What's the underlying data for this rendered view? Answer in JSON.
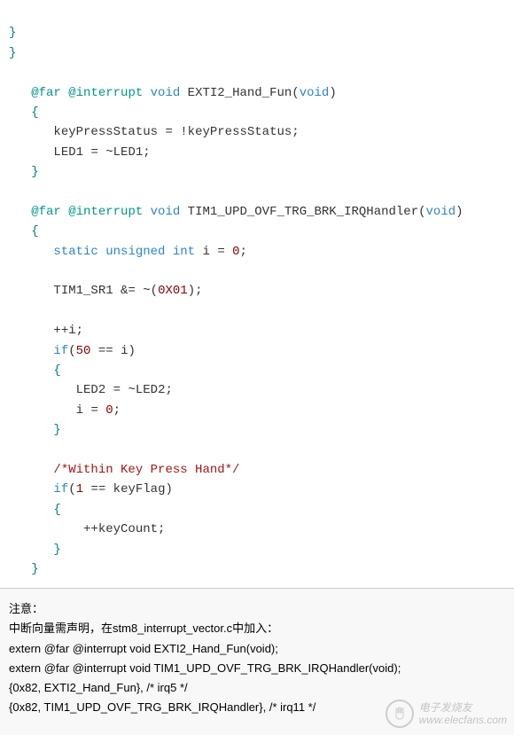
{
  "code": {
    "l1": "}",
    "l2": "}",
    "fn1_kw1": "@far",
    "fn1_kw2": "@interrupt",
    "fn1_ret": "void",
    "fn1_name": "EXTI2_Hand_Fun",
    "fn1_param": "void",
    "fn1_body1_lhs": "keyPressStatus",
    "fn1_body1_rhs": "keyPressStatus",
    "fn1_body2_lhs": "LED1",
    "fn1_body2_rhs": "LED1",
    "fn2_kw1": "@far",
    "fn2_kw2": "@interrupt",
    "fn2_ret": "void",
    "fn2_name": "TIM1_UPD_OVF_TRG_BRK_IRQHandler",
    "fn2_param": "void",
    "fn2_static": "static",
    "fn2_unsigned": "unsigned",
    "fn2_int": "int",
    "fn2_var_i": "i",
    "fn2_zero": "0",
    "fn2_reg": "TIM1_SR1",
    "fn2_mask": "0X01",
    "fn2_inc_i": "i",
    "fn2_if_num": "50",
    "fn2_if_var": "i",
    "fn2_led_lhs": "LED2",
    "fn2_led_rhs": "LED2",
    "fn2_reset_i": "i",
    "fn2_reset_val": "0",
    "fn2_comment": "/*Within Key Press Hand*/",
    "fn2_if2_num": "1",
    "fn2_if2_var": "keyFlag",
    "fn2_inc_count": "keyCount",
    "kw_if": "if"
  },
  "note": {
    "title": "注意：",
    "line1": "中断向量需声明，在stm8_interrupt_vector.c中加入：",
    "line2": "extern @far @interrupt void EXTI2_Hand_Fun(void);",
    "line3": "extern @far @interrupt void TIM1_UPD_OVF_TRG_BRK_IRQHandler(void);",
    "line4": "{0x82, EXTI2_Hand_Fun}, /* irq5  */",
    "line5": "{0x82, TIM1_UPD_OVF_TRG_BRK_IRQHandler}, /* irq11 */"
  },
  "watermark": {
    "line1": "电子发烧友",
    "line2": "www.elecfans.com"
  }
}
